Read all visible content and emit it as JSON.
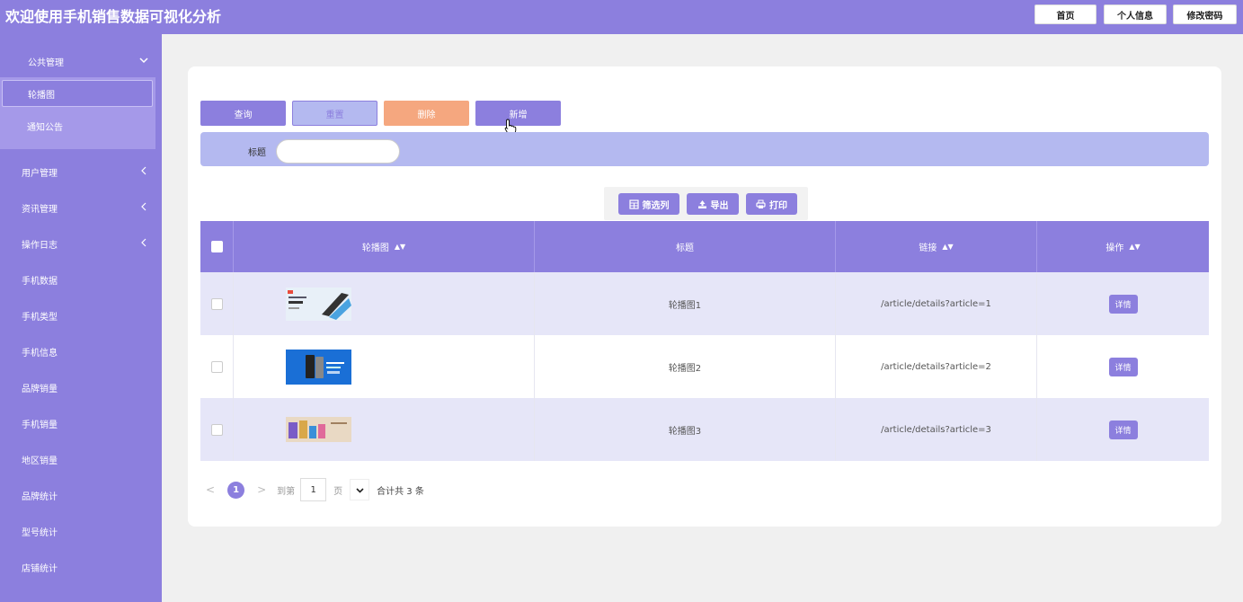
{
  "header": {
    "title": "欢迎使用手机销售数据可视化分析",
    "buttons": [
      "首页",
      "个人信息",
      "修改密码"
    ]
  },
  "sidebar": {
    "group_title": "公共管理",
    "sub_items": [
      "轮播图",
      "通知公告"
    ],
    "items": [
      "用户管理",
      "资讯管理",
      "操作日志",
      "手机数据",
      "手机类型",
      "手机信息",
      "品牌销量",
      "手机销量",
      "地区销量",
      "品牌统计",
      "型号统计",
      "店铺统计"
    ]
  },
  "actions": {
    "query": "查询",
    "reset": "重置",
    "delete": "删除",
    "add": "新增"
  },
  "search": {
    "label": "标题",
    "value": "",
    "placeholder": ""
  },
  "toolbar": {
    "filter": "筛选列",
    "export": "导出",
    "print": "打印"
  },
  "table": {
    "headers": [
      "轮播图",
      "标题",
      "链接",
      "操作"
    ],
    "rows": [
      {
        "title": "轮播图1",
        "link": "/article/details?article=1",
        "action": "详情"
      },
      {
        "title": "轮播图2",
        "link": "/article/details?article=2",
        "action": "详情"
      },
      {
        "title": "轮播图3",
        "link": "/article/details?article=3",
        "action": "详情"
      }
    ]
  },
  "pagination": {
    "current": "1",
    "goto_label": "到第",
    "page_input": "1",
    "page_unit": "页",
    "total_text": "合计共 3 条"
  },
  "colors": {
    "primary": "#8c7fde",
    "search_bg": "#b4b9f0",
    "delete": "#f5a77f",
    "row_alt": "#e6e6f8"
  }
}
